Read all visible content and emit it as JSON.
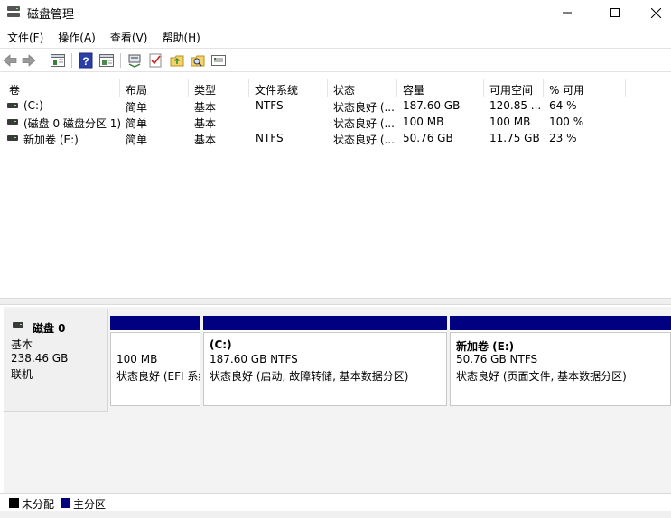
{
  "window": {
    "title": "磁盘管理"
  },
  "menu": [
    "文件(F)",
    "操作(A)",
    "查看(V)",
    "帮助(H)"
  ],
  "toolbar": {
    "icons": [
      "back-arrow-icon",
      "forward-arrow-icon",
      "console-tree-icon",
      "help-icon",
      "properties-icon",
      "connect-icon",
      "check-icon",
      "folder-up-icon",
      "search-icon",
      "options-icon"
    ]
  },
  "volume_list": {
    "columns": [
      "卷",
      "布局",
      "类型",
      "文件系统",
      "状态",
      "容量",
      "可用空间",
      "% 可用"
    ],
    "rows": [
      [
        "(C:)",
        "简单",
        "基本",
        "NTFS",
        "状态良好 (...",
        "187.60 GB",
        "120.85 ...",
        "64 %"
      ],
      [
        "(磁盘 0 磁盘分区 1)",
        "简单",
        "基本",
        "",
        "状态良好 (...",
        "100 MB",
        "100 MB",
        "100 %"
      ],
      [
        "新加卷 (E:)",
        "简单",
        "基本",
        "NTFS",
        "状态良好 (...",
        "50.76 GB",
        "11.75 GB",
        "23 %"
      ]
    ]
  },
  "disk": {
    "name": "磁盘 0",
    "type": "基本",
    "size": "238.46 GB",
    "status": "联机",
    "partitions": [
      {
        "title": "",
        "size": "100 MB",
        "status": "状态良好 (EFI 系统分区)"
      },
      {
        "title": "(C:)",
        "size": "187.60 GB NTFS",
        "status": "状态良好 (启动, 故障转储, 基本数据分区)"
      },
      {
        "title": "新加卷  (E:)",
        "size": "50.76 GB NTFS",
        "status": "状态良好 (页面文件, 基本数据分区)"
      }
    ]
  },
  "legend": [
    {
      "label": "未分配",
      "color": "#000000"
    },
    {
      "label": "主分区",
      "color": "#000080"
    }
  ]
}
